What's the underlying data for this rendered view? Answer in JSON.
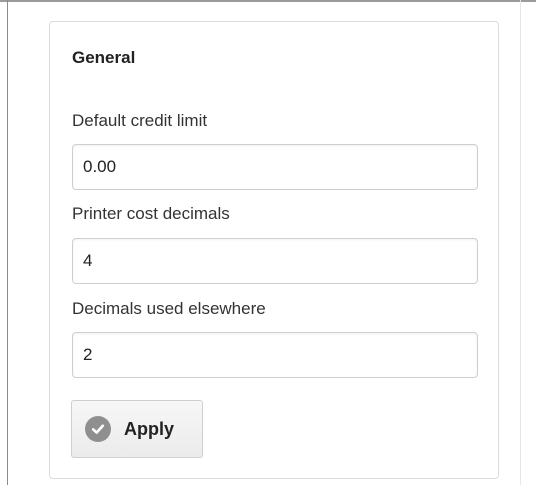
{
  "panel": {
    "title": "General"
  },
  "fields": [
    {
      "label": "Default credit limit",
      "value": "0.00"
    },
    {
      "label": "Printer cost decimals",
      "value": "4"
    },
    {
      "label": "Decimals used elsewhere",
      "value": "2"
    }
  ],
  "apply_button": {
    "label": "Apply",
    "icon": "check-circle-icon"
  }
}
